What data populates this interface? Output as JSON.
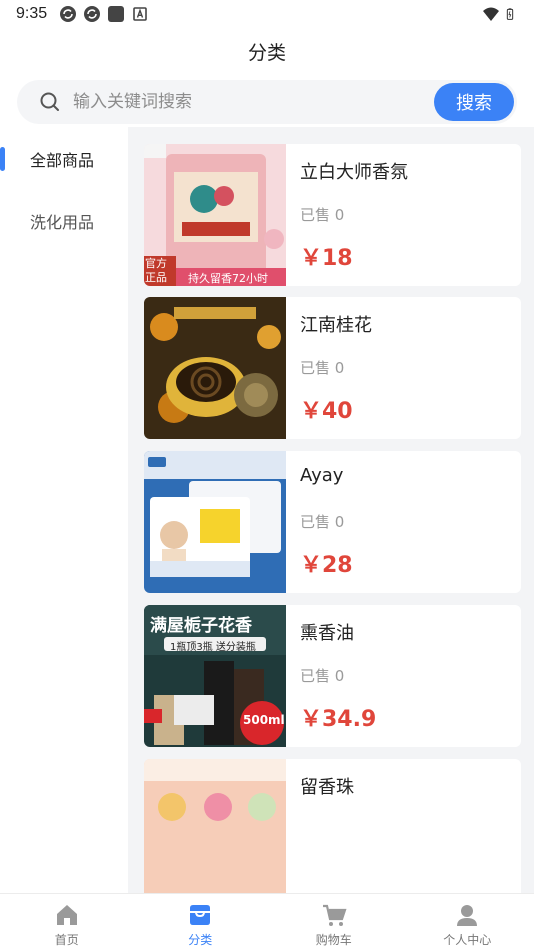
{
  "status_bar": {
    "time": "9:35",
    "icons_left": [
      "sync-icon",
      "sync-icon",
      "square-icon",
      "letter-a-icon"
    ],
    "icons_right": [
      "wifi-icon",
      "battery-icon"
    ]
  },
  "header": {
    "title": "分类"
  },
  "search": {
    "placeholder": "输入关键词搜索",
    "button_label": "搜索",
    "accent": "#3b82f6"
  },
  "sidebar": {
    "items": [
      {
        "label": "全部商品",
        "active": true
      },
      {
        "label": "洗化用品",
        "active": false
      }
    ]
  },
  "products": [
    {
      "name": "立白大师香氛",
      "sold": "已售 0",
      "price": "￥18",
      "image_badge": "官方正品",
      "image_caption": "持久留香72小时"
    },
    {
      "name": "江南桂花",
      "sold": "已售 0",
      "price": "￥40"
    },
    {
      "name": "Ayay",
      "sold": "已售 0",
      "price": "￥28"
    },
    {
      "name": "熏香油",
      "sold": "已售 0",
      "price": "￥34.9",
      "image_headline": "满屋栀子花香",
      "image_sub": "1瓶顶3瓶 送分装瓶",
      "image_badge": "500ml"
    },
    {
      "name": "留香珠",
      "sold": "",
      "price": ""
    }
  ],
  "bottom_nav": {
    "items": [
      {
        "label": "首页",
        "icon": "home-icon",
        "active": false
      },
      {
        "label": "分类",
        "icon": "category-icon",
        "active": true
      },
      {
        "label": "购物车",
        "icon": "cart-icon",
        "active": false
      },
      {
        "label": "个人中心",
        "icon": "user-icon",
        "active": false
      }
    ]
  },
  "colors": {
    "price": "#e0463b",
    "accent": "#3b82f6",
    "inactive": "#9a9a9a"
  }
}
